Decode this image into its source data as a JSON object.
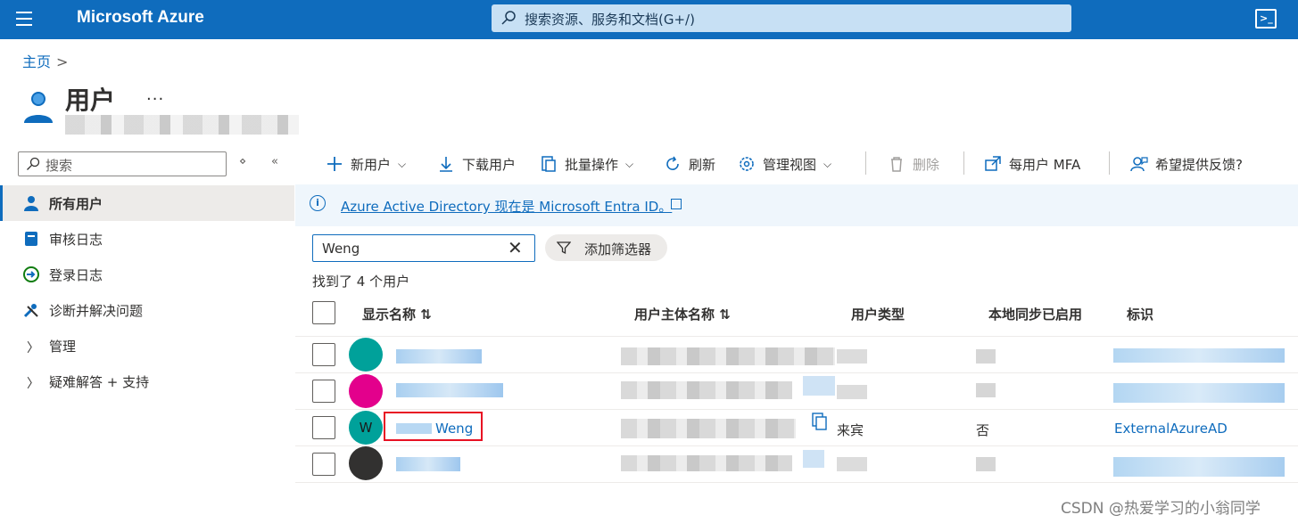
{
  "topbar": {
    "brand": "Microsoft Azure",
    "search_placeholder": "搜索资源、服务和文档(G+/)",
    "cloudshell_glyph": ">_"
  },
  "breadcrumb": {
    "home": "主页",
    "separator": ">"
  },
  "header": {
    "title": "用户",
    "more": "..."
  },
  "nav": {
    "search_placeholder": "搜索",
    "collapse_controls": [
      "⋄",
      "«"
    ],
    "items": [
      {
        "label": "所有用户",
        "icon": "user-icon",
        "active": true
      },
      {
        "label": "审核日志",
        "icon": "audit-log-icon"
      },
      {
        "label": "登录日志",
        "icon": "sign-in-icon"
      },
      {
        "label": "诊断并解决问题",
        "icon": "wrench-icon"
      },
      {
        "label": "管理",
        "icon": "chevron-right-icon"
      },
      {
        "label": "疑难解答 + 支持",
        "icon": "chevron-right-icon"
      }
    ]
  },
  "toolbar": {
    "new_user": "新用户",
    "download_users": "下载用户",
    "bulk_ops": "批量操作",
    "refresh": "刷新",
    "manage_view": "管理视图",
    "delete": "删除",
    "per_user_mfa": "每用户 MFA",
    "feedback": "希望提供反馈?"
  },
  "banner": {
    "text": "Azure Active Directory 现在是 Microsoft Entra ID。"
  },
  "filter": {
    "value": "Weng",
    "clear": "✕",
    "add_filter": "添加筛选器"
  },
  "count_text": "找到了 4 个用户",
  "table": {
    "headers": {
      "display_name": "显示名称 ⇅",
      "upn": "用户主体名称 ⇅",
      "user_type": "用户类型",
      "onprem_sync": "本地同步已启用",
      "identities": "标识"
    },
    "rows": [
      {
        "avatar_color": "#00a19a",
        "avatar_text": "",
        "name": "",
        "user_type": "",
        "sync": "",
        "identity": ""
      },
      {
        "avatar_color": "#e3008c",
        "avatar_text": "",
        "name": "",
        "user_type": "",
        "sync": "",
        "identity": ""
      },
      {
        "avatar_color": "#00a19a",
        "avatar_text": "W",
        "name": "Weng",
        "user_type": "来宾",
        "sync": "否",
        "identity": "ExternalAzureAD"
      },
      {
        "avatar_color": "#323130",
        "avatar_text": "",
        "name": "",
        "user_type": "",
        "sync": "",
        "identity": ""
      }
    ]
  },
  "watermark": "CSDN @热爱学习的小翁同学"
}
